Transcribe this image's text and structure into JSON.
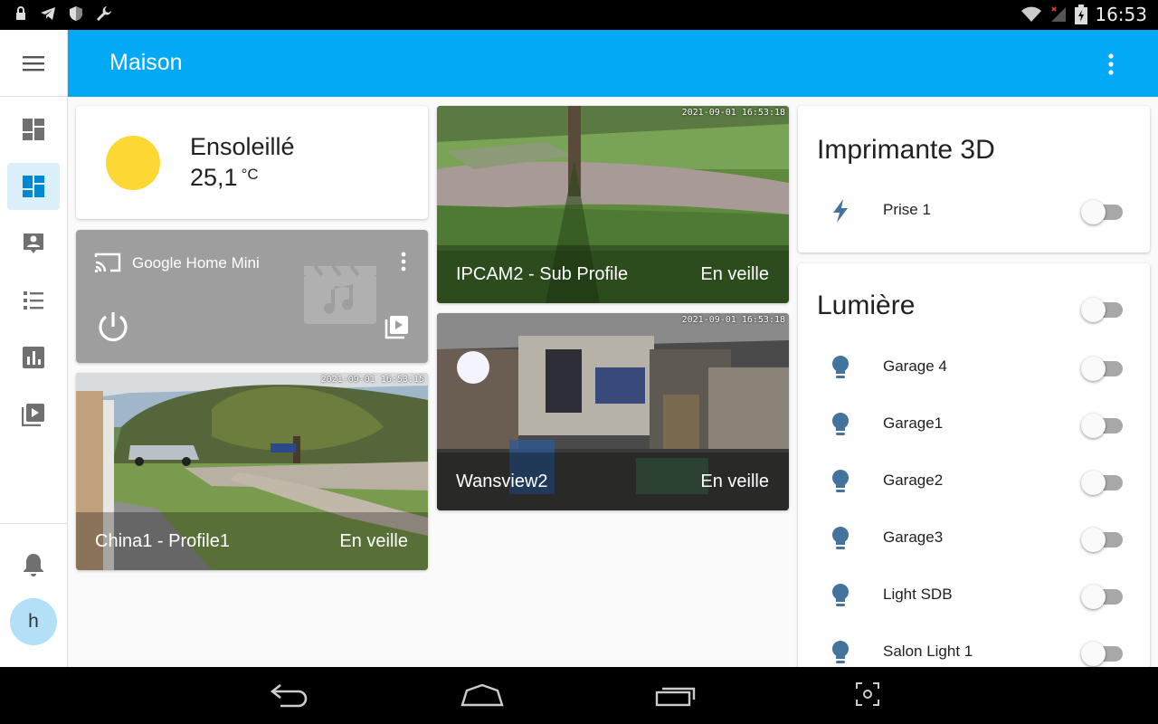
{
  "status_bar": {
    "time": "16:53"
  },
  "app_bar": {
    "title": "Maison"
  },
  "sidebar": {
    "items": [
      {
        "name": "overview-icon"
      },
      {
        "name": "dashboard-icon",
        "active": true
      },
      {
        "name": "logbook-icon"
      },
      {
        "name": "list-icon"
      },
      {
        "name": "history-icon"
      },
      {
        "name": "media-icon"
      }
    ],
    "user_initial": "h"
  },
  "weather": {
    "condition": "Ensoleillé",
    "temperature": "25,1",
    "unit": "°C"
  },
  "media_player": {
    "name": "Google Home Mini"
  },
  "cameras": [
    {
      "name": "China1 - Profile1",
      "state": "En veille",
      "timestamp": "2021-09-01 16:53:15"
    },
    {
      "name": "IPCAM2 - Sub Profile",
      "state": "En veille",
      "timestamp": "2021-09-01 16:53:18"
    },
    {
      "name": "Wansview2",
      "state": "En veille",
      "timestamp": "2021-09-01 16:53:18"
    }
  ],
  "printer_card": {
    "title": "Imprimante 3D",
    "entities": [
      {
        "label": "Prise 1",
        "icon": "flash-icon",
        "on": false
      }
    ]
  },
  "lights_card": {
    "title": "Lumière",
    "header_toggle": false,
    "entities": [
      {
        "label": "Garage 4",
        "icon": "lightbulb-icon",
        "on": false
      },
      {
        "label": "Garage1",
        "icon": "lightbulb-icon",
        "on": false
      },
      {
        "label": "Garage2",
        "icon": "lightbulb-icon",
        "on": false
      },
      {
        "label": "Garage3",
        "icon": "lightbulb-icon",
        "on": false
      },
      {
        "label": "Light SDB",
        "icon": "lightbulb-icon",
        "on": false
      },
      {
        "label": "Salon Light 1",
        "icon": "lightbulb-icon",
        "on": false
      }
    ]
  },
  "colors": {
    "accent": "#03a9f4",
    "icon_blue": "#44739e"
  }
}
